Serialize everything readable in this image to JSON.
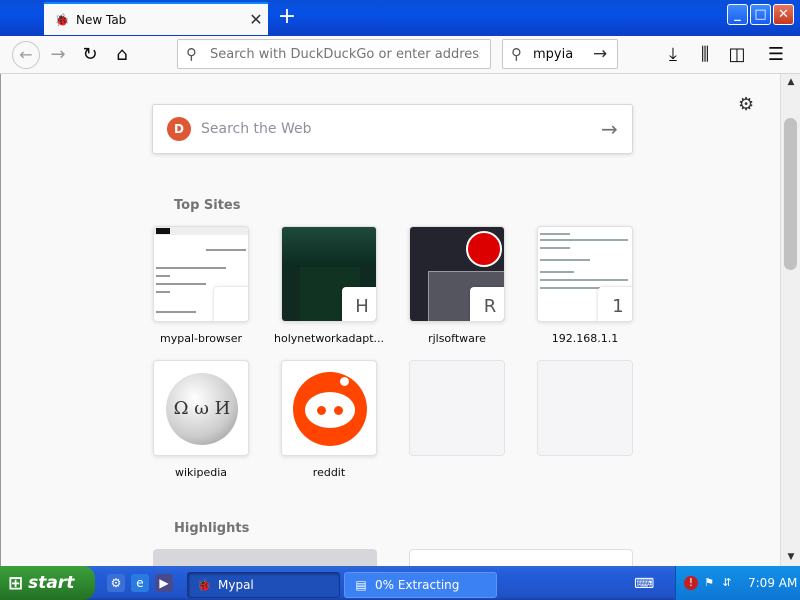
{
  "browser": {
    "tab": {
      "title": "New Tab",
      "favicon": "mypal-icon"
    },
    "new_tab_symbol": "+",
    "window_controls": {
      "minimize": "_",
      "maximize": "□",
      "close": "✕"
    },
    "toolbar": {
      "address_placeholder": "Search with DuckDuckGo or enter address",
      "search_value": "mpyia",
      "icons": [
        "back-icon",
        "forward-icon",
        "reload-icon",
        "home-icon",
        "download-icon",
        "library-icon",
        "sidebar-icon",
        "menu-icon"
      ]
    }
  },
  "newtab": {
    "search_placeholder": "Search the Web",
    "search_engine_logo": "D",
    "top_sites_title": "Top Sites",
    "highlights_title": "Highlights",
    "top_sites": [
      {
        "label": "mypal-browser",
        "badge": ""
      },
      {
        "label": "holynetworkadapt...",
        "badge": "H"
      },
      {
        "label": "rjlsoftware",
        "badge": "R"
      },
      {
        "label": "192.168.1.1",
        "badge": "1"
      },
      {
        "label": "wikipedia",
        "badge": ""
      },
      {
        "label": "reddit",
        "badge": ""
      }
    ],
    "wikipedia_glyph": "Ω ω И"
  },
  "taskbar": {
    "start_label": "start",
    "tasks": [
      {
        "label": "Mypal",
        "active": true
      },
      {
        "label": "0% Extracting",
        "active": false
      }
    ],
    "clock": "7:09 AM"
  }
}
